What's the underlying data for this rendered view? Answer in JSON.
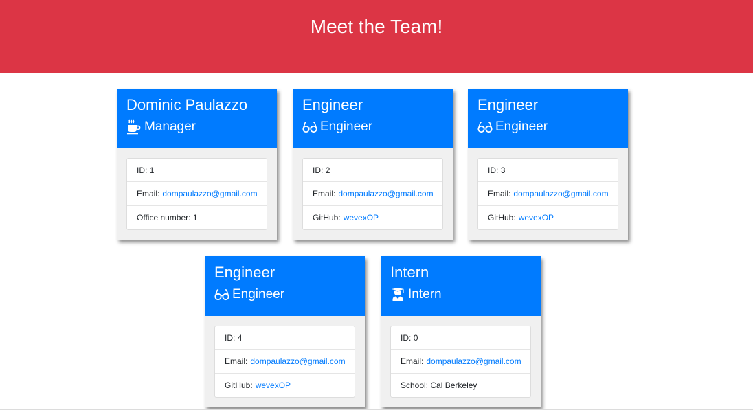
{
  "header": {
    "title": "Meet the Team!"
  },
  "team": [
    {
      "name": "Dominic Paulazzo",
      "role": "Manager",
      "icon": "coffee-icon",
      "id_label": "ID:",
      "id": "1",
      "email_label": "Email:",
      "email": "dompaulazzo@gmail.com",
      "extra_label": "Office number:",
      "extra": "1"
    },
    {
      "name": "Engineer",
      "role": "Engineer",
      "icon": "glasses-icon",
      "id_label": "ID:",
      "id": "2",
      "email_label": "Email:",
      "email": "dompaulazzo@gmail.com",
      "extra_label": "GitHub:",
      "extra": "wevexOP"
    },
    {
      "name": "Engineer",
      "role": "Engineer",
      "icon": "glasses-icon",
      "id_label": "ID:",
      "id": "3",
      "email_label": "Email:",
      "email": "dompaulazzo@gmail.com",
      "extra_label": "GitHub:",
      "extra": "wevexOP"
    },
    {
      "name": "Engineer",
      "role": "Engineer",
      "icon": "glasses-icon",
      "id_label": "ID:",
      "id": "4",
      "email_label": "Email:",
      "email": "dompaulazzo@gmail.com",
      "extra_label": "GitHub:",
      "extra": "wevexOP"
    },
    {
      "name": "Intern",
      "role": "Intern",
      "icon": "graduate-icon",
      "id_label": "ID:",
      "id": "0",
      "email_label": "Email:",
      "email": "dompaulazzo@gmail.com",
      "extra_label": "School:",
      "extra": "Cal Berkeley"
    }
  ],
  "colors": {
    "header_bg": "#dc3545",
    "card_header_bg": "#007bff",
    "link": "#007bff"
  }
}
